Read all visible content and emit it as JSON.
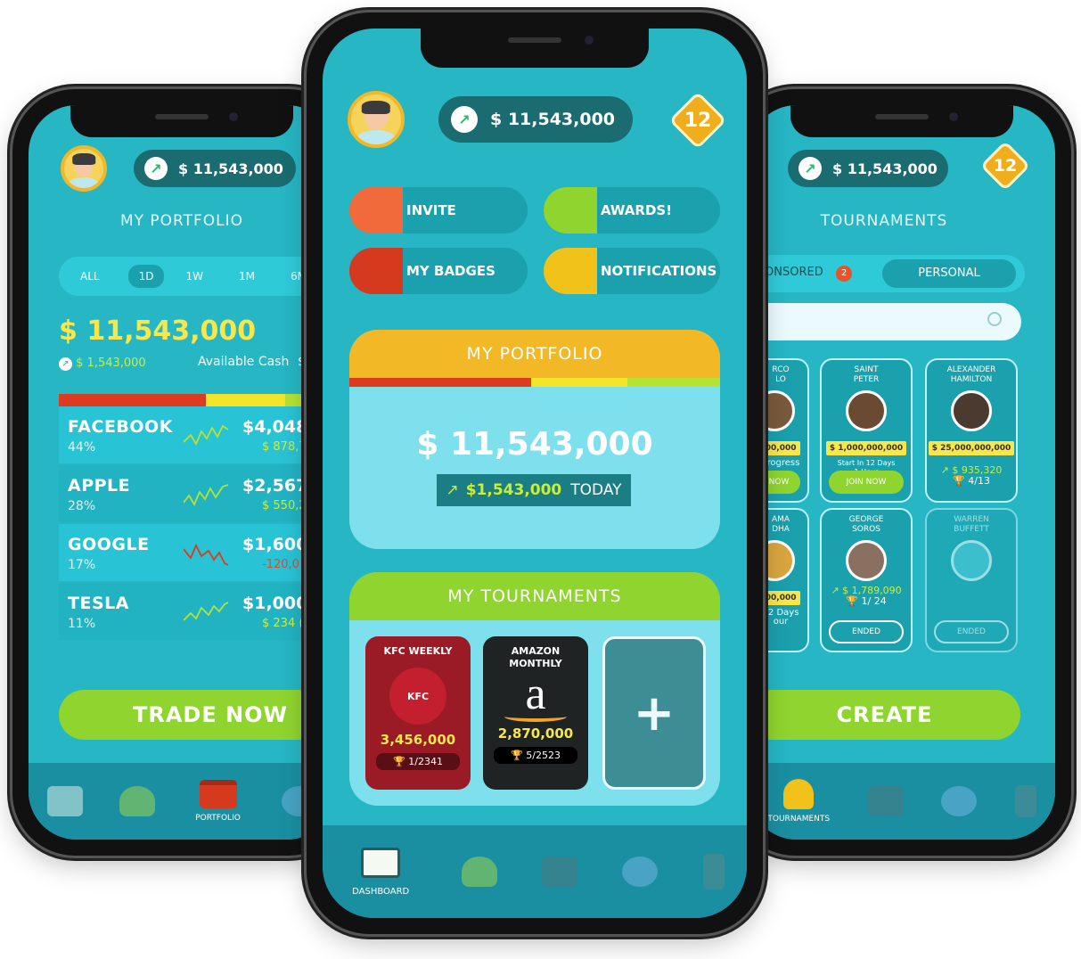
{
  "balance": "$ 11,543,000",
  "level": "12",
  "left": {
    "title": "MY PORTFOLIO",
    "periods": [
      "ALL",
      "1D",
      "1W",
      "1M",
      "6M"
    ],
    "active_period": "1D",
    "total": "$ 11,543,000",
    "gain": "$ 1,543,000",
    "cash_label": "Available Cash",
    "cash_value": "$2,",
    "stocks": [
      {
        "name": "FACEBOOK",
        "pct": "44%",
        "value": "$4,048,0",
        "change": "$ 878,7"
      },
      {
        "name": "APPLE",
        "pct": "28%",
        "value": "$2,567,00",
        "change": "$ 550,2"
      },
      {
        "name": "GOOGLE",
        "pct": "17%",
        "value": "$1,600,00",
        "change": "-120,0"
      },
      {
        "name": "TESLA",
        "pct": "11%",
        "value": "$1,000,40",
        "change": "$ 234 ("
      }
    ],
    "trade_button": "TRADE NOW",
    "active_tab": "PORTFOLIO"
  },
  "center": {
    "menu": {
      "invite": "INVITE",
      "awards": "AWARDS!",
      "badges": "MY BADGES",
      "notifications": "NOTIFICATIONS"
    },
    "portfolio_title": "MY PORTFOLIO",
    "portfolio_total": "$ 11,543,000",
    "today_gain": "$1,543,000",
    "today_label": "TODAY",
    "tournaments_title": "MY TOURNAMENTS",
    "tournaments": [
      {
        "name": "KFC WEEKLY",
        "logo": "KFC",
        "amount": "3,456,000",
        "rank": "1/2341"
      },
      {
        "name": "AMAZON MONTHLY",
        "logo": "a",
        "amount": "2,870,000",
        "rank": "5/2523"
      }
    ],
    "add_symbol": "+",
    "active_tab": "DASHBOARD"
  },
  "right": {
    "title": "TOURNAMENTS",
    "tab_sponsored": "ONSORED",
    "sponsored_count": "2",
    "tab_personal": "PERSONAL",
    "cards": [
      {
        "name": "RCO\nLO",
        "prize": "000,000",
        "sub": "Progress",
        "btn": "NOW"
      },
      {
        "name": "SAINT\nPETER",
        "prize": "$ 1,000,000,000",
        "sub": "Start In 12 Days\n1 Hour",
        "btn": "JOIN NOW"
      },
      {
        "name": "ALEXANDER\nHAMILTON",
        "prize": "$ 25,000,000,000",
        "gain": "$ 935,320",
        "rank": "4/13"
      },
      {
        "name": "AMA\nDHA",
        "prize": "000,000",
        "sub": "12 Days\nour"
      },
      {
        "name": "GEORGE\nSOROS",
        "gain": "$ 1,789,090",
        "rank": "1/ 24",
        "btn": "ENDED"
      },
      {
        "name": "WARREN\nBUFFETT",
        "btn": "ENDED"
      }
    ],
    "create_button": "CREATE",
    "active_tab": "TOURNAMENTS"
  },
  "colors": {
    "screen": "#26b6c4",
    "dark_pill": "#1a6c70",
    "green": "#8fd42f",
    "orange": "#f0ae1c",
    "red": "#dc3b1f",
    "yellow": "#f3e52a"
  }
}
